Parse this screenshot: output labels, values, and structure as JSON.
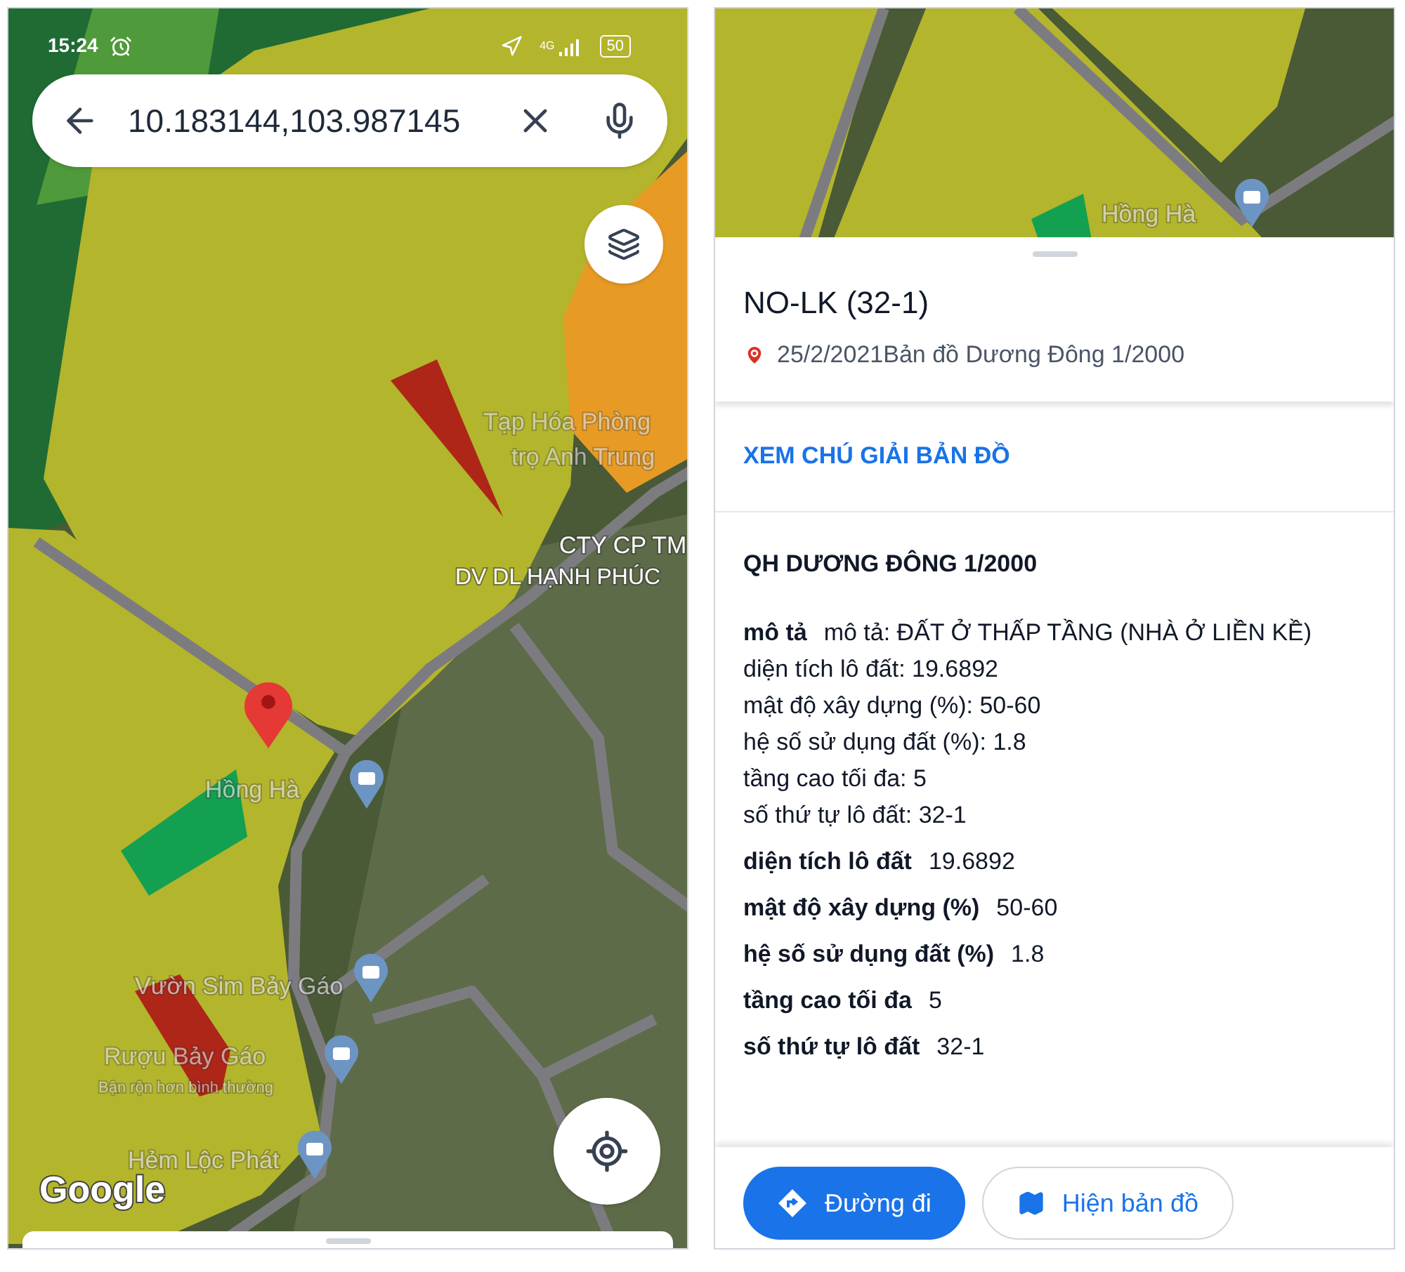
{
  "status_bar": {
    "time": "15:24",
    "network": "4G",
    "battery": "50"
  },
  "search": {
    "value": "10.183144,103.987145"
  },
  "map_labels": [
    {
      "text": "Tạp Hóa Phòng"
    },
    {
      "text": "trọ Anh Trung"
    },
    {
      "text": "CTY CP TM"
    },
    {
      "text": "DV DL HẠNH PHÚC"
    },
    {
      "text": "Hồng Hà"
    },
    {
      "text": "Vườn Sim Bảy Gáo"
    },
    {
      "text": "Rượu Bảy Gáo"
    },
    {
      "text": "Bận rộn hơn bình thường"
    },
    {
      "text": "Hẻm Lộc Phát"
    }
  ],
  "map_logo": "Google",
  "preview_map_labels": [
    {
      "text": "Hồng Hà"
    }
  ],
  "place": {
    "title": "NO-LK (32-1)",
    "subtitle": "25/2/2021Bản đồ Dương Đông 1/2000",
    "legend_link": "XEM CHÚ GIẢI BẢN ĐỒ",
    "section_title": "QH DƯƠNG ĐÔNG 1/2000",
    "description": {
      "label": "mô tả",
      "value": "mô tả: ĐẤT Ở THẤP TẦNG (NHÀ Ở LIỀN KỀ)"
    },
    "lines": [
      "diện tích lô đất: 19.6892",
      "mật độ xây dựng (%): 50-60",
      "hệ số sử dụng đất (%): 1.8",
      "tầng cao tối đa: 5",
      "số thứ tự lô đất: 32-1"
    ],
    "attributes": [
      {
        "label": "diện tích lô đất",
        "value": "19.6892"
      },
      {
        "label": "mật độ xây dựng (%)",
        "value": "50-60"
      },
      {
        "label": "hệ số sử dụng đất (%)",
        "value": "1.8"
      },
      {
        "label": "tầng cao tối đa",
        "value": "5"
      },
      {
        "label": "số thứ tự lô đất",
        "value": "32-1"
      }
    ]
  },
  "buttons": [
    {
      "label": "Đường đi",
      "kind": "primary"
    },
    {
      "label": "Hiện bản đồ",
      "kind": "secondary"
    }
  ]
}
